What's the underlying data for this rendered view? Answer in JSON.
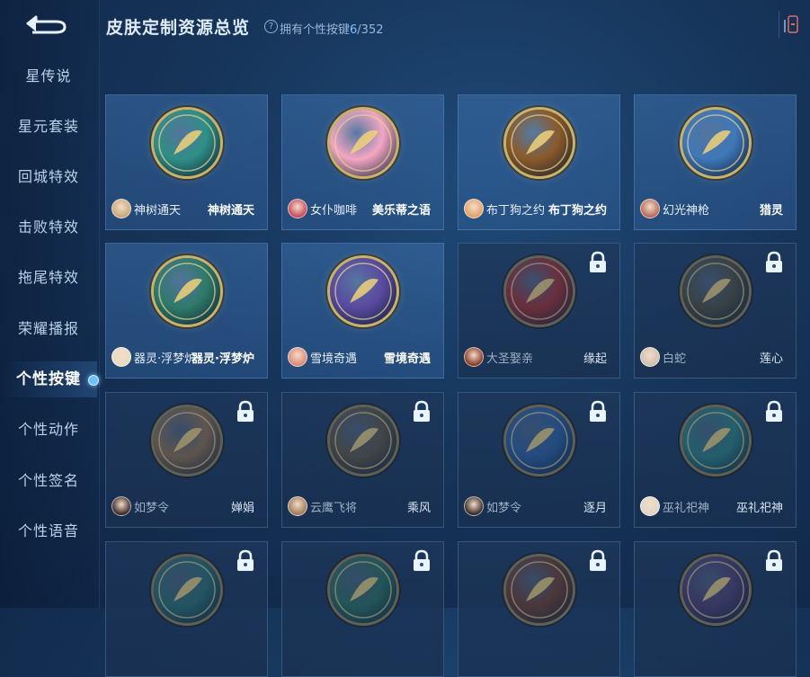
{
  "header": {
    "title": "皮肤定制资源总览",
    "owned_prefix": "拥有个性按键",
    "owned_count": "6",
    "owned_total": "/352"
  },
  "sidebar": {
    "items": [
      {
        "label": "星传说"
      },
      {
        "label": "星元套装"
      },
      {
        "label": "回城特效"
      },
      {
        "label": "击败特效"
      },
      {
        "label": "拖尾特效"
      },
      {
        "label": "荣耀播报"
      },
      {
        "label": "个性按键",
        "active": true
      },
      {
        "label": "个性动作"
      },
      {
        "label": "个性签名"
      },
      {
        "label": "个性语音"
      }
    ]
  },
  "colors": {
    "accent": "#6fc1ff",
    "background": "#163459",
    "gold_ring": "#c9b36a"
  },
  "cards": [
    {
      "skin": "神树通天",
      "item": "神树通天",
      "locked": false,
      "emblem_color": "#2f8f86",
      "avatar_color": "#c8a77a",
      "icon": "golden-leaves-icon"
    },
    {
      "skin": "女仆咖啡",
      "item": "美乐蒂之语",
      "locked": false,
      "emblem_color": "#f3a6c2",
      "avatar_color": "#c84a5c",
      "icon": "melody-bunny-icon"
    },
    {
      "skin": "布丁狗之约",
      "item": "布丁狗之约",
      "locked": false,
      "emblem_color": "#8a5a2a",
      "avatar_color": "#e3a16a",
      "icon": "golden-key-icon"
    },
    {
      "skin": "幻光神枪",
      "item": "猎灵",
      "locked": false,
      "emblem_color": "#3f77b8",
      "avatar_color": "#b86a5a",
      "icon": "light-spear-icon"
    },
    {
      "skin": "器灵·浮梦炉",
      "item": "器灵·浮梦炉",
      "locked": false,
      "emblem_color": "#2f7a6a",
      "avatar_color": "#e8dcc0",
      "icon": "golden-incense-burner-icon"
    },
    {
      "skin": "雪境奇遇",
      "item": "雪境奇遇",
      "locked": false,
      "emblem_color": "#5a4aa0",
      "avatar_color": "#d98a7a",
      "icon": "purple-flower-icon"
    },
    {
      "skin": "大圣娶亲",
      "item": "缘起",
      "locked": true,
      "emblem_color": "#9a2a2a",
      "avatar_color": "#8a3a2a",
      "icon": "red-scroll-icon"
    },
    {
      "skin": "白蛇",
      "item": "莲心",
      "locked": true,
      "emblem_color": "#4a4a3a",
      "avatar_color": "#d0c0b0",
      "icon": "lotus-icon"
    },
    {
      "skin": "如梦令",
      "item": "婵娟",
      "locked": true,
      "emblem_color": "#8a6a4a",
      "avatar_color": "#3a2a2a",
      "icon": "moon-fan-icon"
    },
    {
      "skin": "云鹰飞将",
      "item": "乘风",
      "locked": true,
      "emblem_color": "#5a5040",
      "avatar_color": "#a07a5a",
      "icon": "golden-blade-icon"
    },
    {
      "skin": "如梦令",
      "item": "逐月",
      "locked": true,
      "emblem_color": "#2a5a9a",
      "avatar_color": "#3a2a2a",
      "icon": "white-crane-icon"
    },
    {
      "skin": "巫礼祀神",
      "item": "巫礼祀神",
      "locked": true,
      "emblem_color": "#2a7a7a",
      "avatar_color": "#e0d6c8",
      "icon": "spirit-fish-icon"
    },
    {
      "skin": "",
      "item": "",
      "locked": true,
      "emblem_color": "#2a6a6a",
      "avatar_color": "#2a6a6a",
      "icon": "crystal-blade-icon"
    },
    {
      "skin": "",
      "item": "",
      "locked": true,
      "emblem_color": "#2a6a5a",
      "avatar_color": "#2a6a5a",
      "icon": "jade-dragon-icon"
    },
    {
      "skin": "",
      "item": "",
      "locked": true,
      "emblem_color": "#6a3a2a",
      "avatar_color": "#6a3a2a",
      "icon": "flame-icon"
    },
    {
      "skin": "",
      "item": "",
      "locked": true,
      "emblem_color": "#4a3a6a",
      "avatar_color": "#4a3a6a",
      "icon": "violet-staff-icon"
    }
  ]
}
